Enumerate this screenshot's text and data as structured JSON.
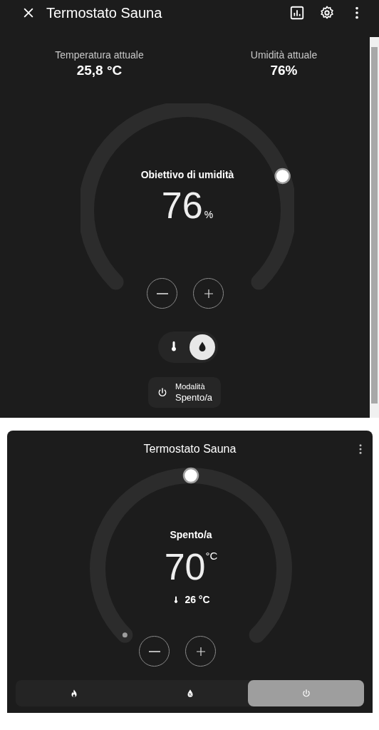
{
  "dialog": {
    "title": "Termostato Sauna",
    "current": [
      {
        "label": "Temperatura attuale",
        "value": "25,8 °C"
      },
      {
        "label": "Umidità attuale",
        "value": "76%"
      }
    ],
    "dial": {
      "label": "Obiettivo di umidità",
      "value": "76",
      "unit": "%"
    },
    "mode_toggle": [
      {
        "kind": "temperature",
        "selected": false
      },
      {
        "kind": "humidity",
        "selected": true
      }
    ],
    "mode_chip": {
      "label": "Modalità",
      "value": "Spento/a"
    }
  },
  "card": {
    "title": "Termostato Sauna",
    "dial": {
      "label": "Spento/a",
      "value": "70",
      "unit": "°C",
      "current": "26 °C"
    },
    "modes": [
      {
        "kind": "heat",
        "selected": false
      },
      {
        "kind": "dry",
        "selected": false
      },
      {
        "kind": "off",
        "selected": true
      }
    ]
  }
}
